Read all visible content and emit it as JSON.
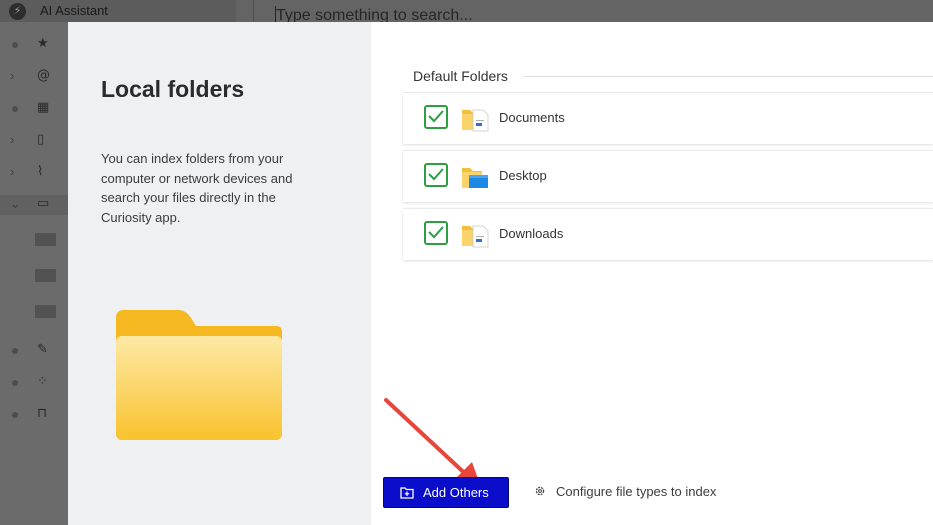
{
  "background": {
    "app_title": "AI Assistant",
    "search_placeholder": "Type something to search...",
    "sidebar_icons": [
      "star-icon",
      "at-icon",
      "calendar-icon",
      "book-icon",
      "paperclip-icon",
      "folder-icon",
      "edit-icon",
      "grid-icon",
      "bookmark-icon"
    ]
  },
  "modal": {
    "title": "Local folders",
    "description": "You can index folders from your computer or network devices and search your files directly in the Curiosity app.",
    "section_label": "Default Folders",
    "folders": [
      {
        "name": "Documents",
        "checked": true,
        "icon": "documents-folder-icon"
      },
      {
        "name": "Desktop",
        "checked": true,
        "icon": "desktop-folder-icon"
      },
      {
        "name": "Downloads",
        "checked": true,
        "icon": "downloads-folder-icon"
      }
    ],
    "add_button_label": "Add Others",
    "config_label": "Configure file types to index"
  },
  "colors": {
    "accent_button": "#0a0dc9",
    "check_green": "#2e9e42",
    "annotation_arrow": "#e8463a",
    "folder_yellow": "#f9c22e"
  }
}
